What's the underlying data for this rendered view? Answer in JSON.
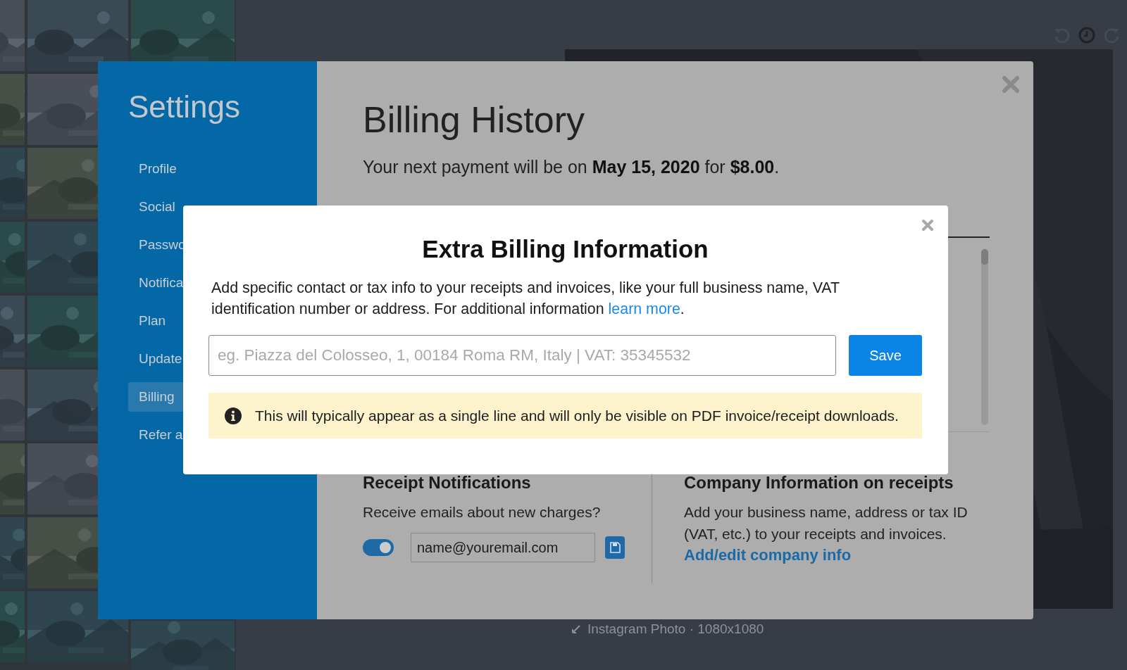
{
  "editor": {
    "caption": "Instagram Photo · 1080x1080"
  },
  "settings": {
    "title": "Settings",
    "nav": [
      {
        "label": "Profile",
        "selected": false
      },
      {
        "label": "Social",
        "selected": false
      },
      {
        "label": "Passwo",
        "selected": false
      },
      {
        "label": "Notifica",
        "selected": false
      },
      {
        "label": "Plan",
        "selected": false
      },
      {
        "label": "Update",
        "selected": false
      },
      {
        "label": "Billing",
        "selected": true
      },
      {
        "label": "Refer a",
        "selected": false
      }
    ]
  },
  "billing": {
    "title": "Billing History",
    "subtitle": "Your next payment will be on **May 15, 2020** for **$8.00**.",
    "receipts": {
      "heading": "Receipt Notifications",
      "question": "Receive emails about new charges?",
      "toggle_on": true,
      "email": "name@youremail.com"
    },
    "company": {
      "heading": "Company Information on receipts",
      "text": "Add your business name, address or tax ID (VAT, etc.) to your receipts and invoices.",
      "link": "Add/edit company info"
    }
  },
  "modal": {
    "title": "Extra Billing Information",
    "description": "Add specific contact or tax info to your receipts and invoices, like your full business name, VAT identification number or address. For additional information ",
    "link": "learn more",
    "description_end": ".",
    "placeholder": "eg. Piazza del Colosseo, 1, 00184 Roma RM, Italy | VAT: 35345532",
    "save": "Save",
    "notice": "This will typically appear as a single line and will only be visible on PDF invoice/receipt downloads."
  }
}
